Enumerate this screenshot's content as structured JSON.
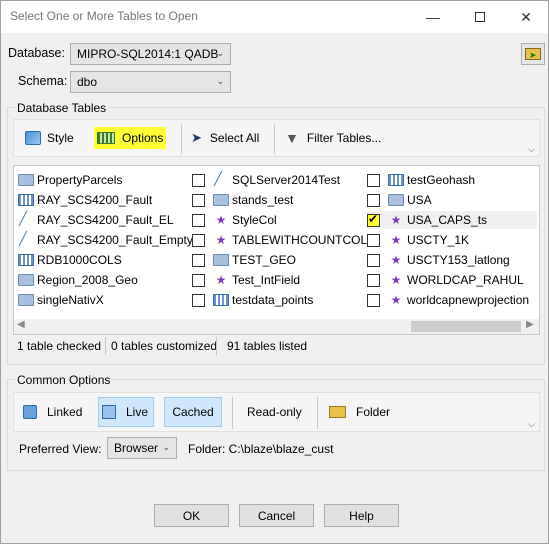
{
  "window": {
    "title": "Select One or More Tables to Open"
  },
  "db_row": {
    "database_label": "Database:",
    "database_value": "MIPRO-SQL2014:1 QADB",
    "schema_label": "Schema:",
    "schema_value": "dbo"
  },
  "db_tables": {
    "group_title": "Database Tables",
    "toolbar": {
      "style": "Style",
      "options": "Options",
      "select_all": "Select All",
      "filter": "Filter Tables..."
    },
    "columns": [
      [
        {
          "name": "PropertyParcels",
          "icon": "polygon-table-icon",
          "checked": null
        },
        {
          "name": "RAY_SCS4200_Fault",
          "icon": "grid-table-icon",
          "checked": null
        },
        {
          "name": "RAY_SCS4200_Fault_EL",
          "icon": "line-table-icon",
          "checked": null
        },
        {
          "name": "RAY_SCS4200_Fault_Empty",
          "icon": "line-table-icon",
          "checked": null
        },
        {
          "name": "RDB1000COLS",
          "icon": "grid-table-icon",
          "checked": null
        },
        {
          "name": "Region_2008_Geo",
          "icon": "polygon-table-icon",
          "checked": null
        },
        {
          "name": "singleNativX",
          "icon": "multi-geometry-icon",
          "checked": null
        }
      ],
      [
        {
          "name": "SQLServer2014Test",
          "icon": "line-table-icon",
          "checked": false
        },
        {
          "name": "stands_test",
          "icon": "polygon-table-icon",
          "checked": false
        },
        {
          "name": "StyleCol",
          "icon": "point-table-icon",
          "checked": false
        },
        {
          "name": "TABLEWITHCOUNTCOL",
          "icon": "point-table-icon",
          "checked": false
        },
        {
          "name": "TEST_GEO",
          "icon": "multi-geometry-icon",
          "checked": false
        },
        {
          "name": "Test_IntField",
          "icon": "point-table-icon",
          "checked": false
        },
        {
          "name": "testdata_points",
          "icon": "grid-table-icon",
          "checked": false
        }
      ],
      [
        {
          "name": "testGeohash",
          "icon": "grid-table-icon",
          "checked": false
        },
        {
          "name": "USA",
          "icon": "polygon-table-icon",
          "checked": false
        },
        {
          "name": "USA_CAPS_ts",
          "icon": "point-table-icon",
          "checked": true
        },
        {
          "name": "USCTY_1K",
          "icon": "point-table-icon",
          "checked": false
        },
        {
          "name": "USCTY153_latlong",
          "icon": "point-table-icon",
          "checked": false
        },
        {
          "name": "WORLDCAP_RAHUL",
          "icon": "point-table-icon",
          "checked": false
        },
        {
          "name": "worldcapnewprojection",
          "icon": "point-table-icon",
          "checked": false
        }
      ]
    ],
    "status": {
      "checked": "1 table checked",
      "customized": "0 tables customized",
      "listed": "91 tables listed"
    }
  },
  "common": {
    "group_title": "Common Options",
    "linked": "Linked",
    "live": "Live",
    "cached": "Cached",
    "readonly": "Read-only",
    "folder": "Folder",
    "preferred_view_label": "Preferred View:",
    "preferred_view_value": "Browser",
    "folder_path": "Folder: C:\\blaze\\blaze_cust"
  },
  "buttons": {
    "ok": "OK",
    "cancel": "Cancel",
    "help": "Help"
  },
  "accent": {
    "highlight": "#ffff33",
    "selected_bg": "#cfe6fb"
  }
}
